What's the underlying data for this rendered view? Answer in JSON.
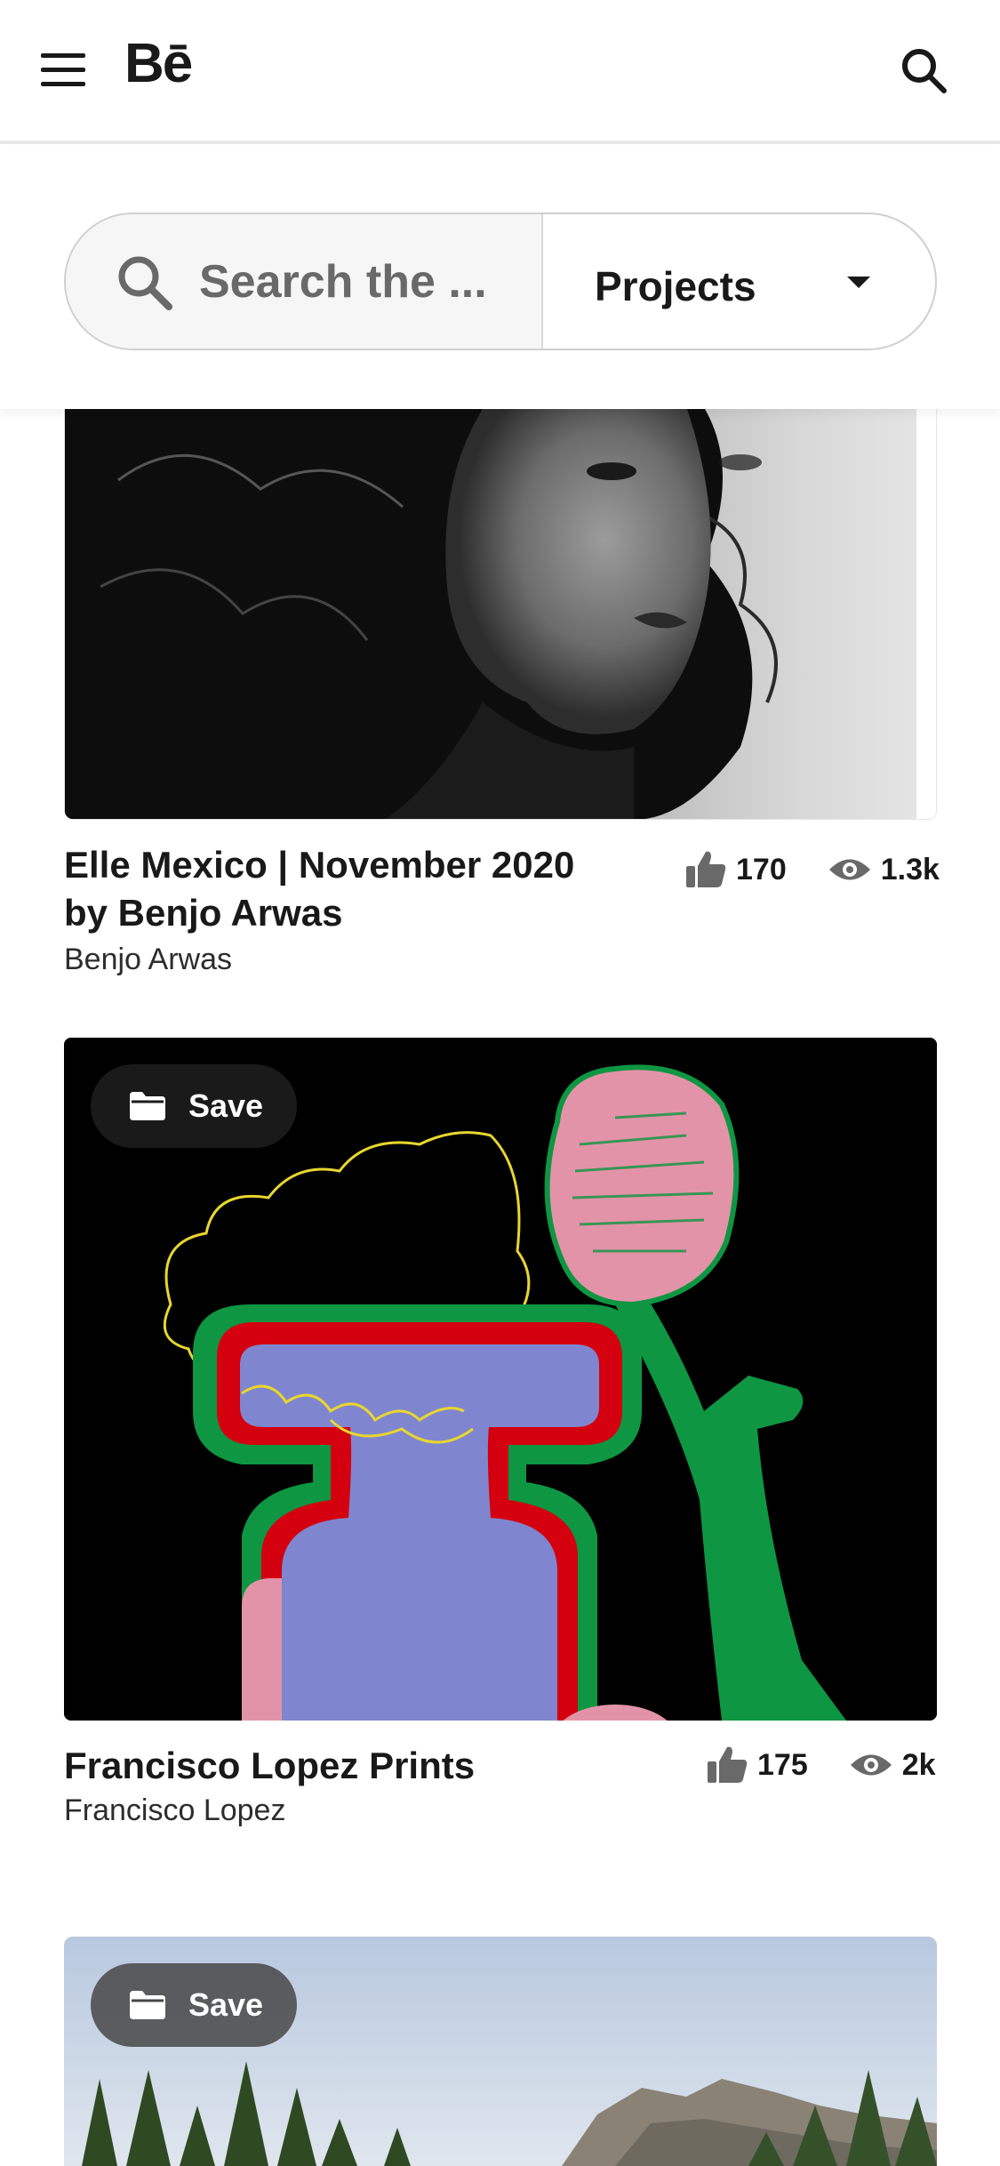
{
  "header": {
    "logo": "Bē"
  },
  "search": {
    "placeholder": "Search the ...",
    "category": "Projects"
  },
  "projects": [
    {
      "title_line1": "Elle Mexico | November 2020",
      "title_line2": "by Benjo Arwas",
      "owner": "Benjo Arwas",
      "likes": "170",
      "views": "1.3k"
    },
    {
      "title": "Francisco Lopez Prints",
      "owner": "Francisco Lopez",
      "likes": "175",
      "views": "2k",
      "save_label": "Save"
    },
    {
      "save_label": "Save"
    }
  ]
}
